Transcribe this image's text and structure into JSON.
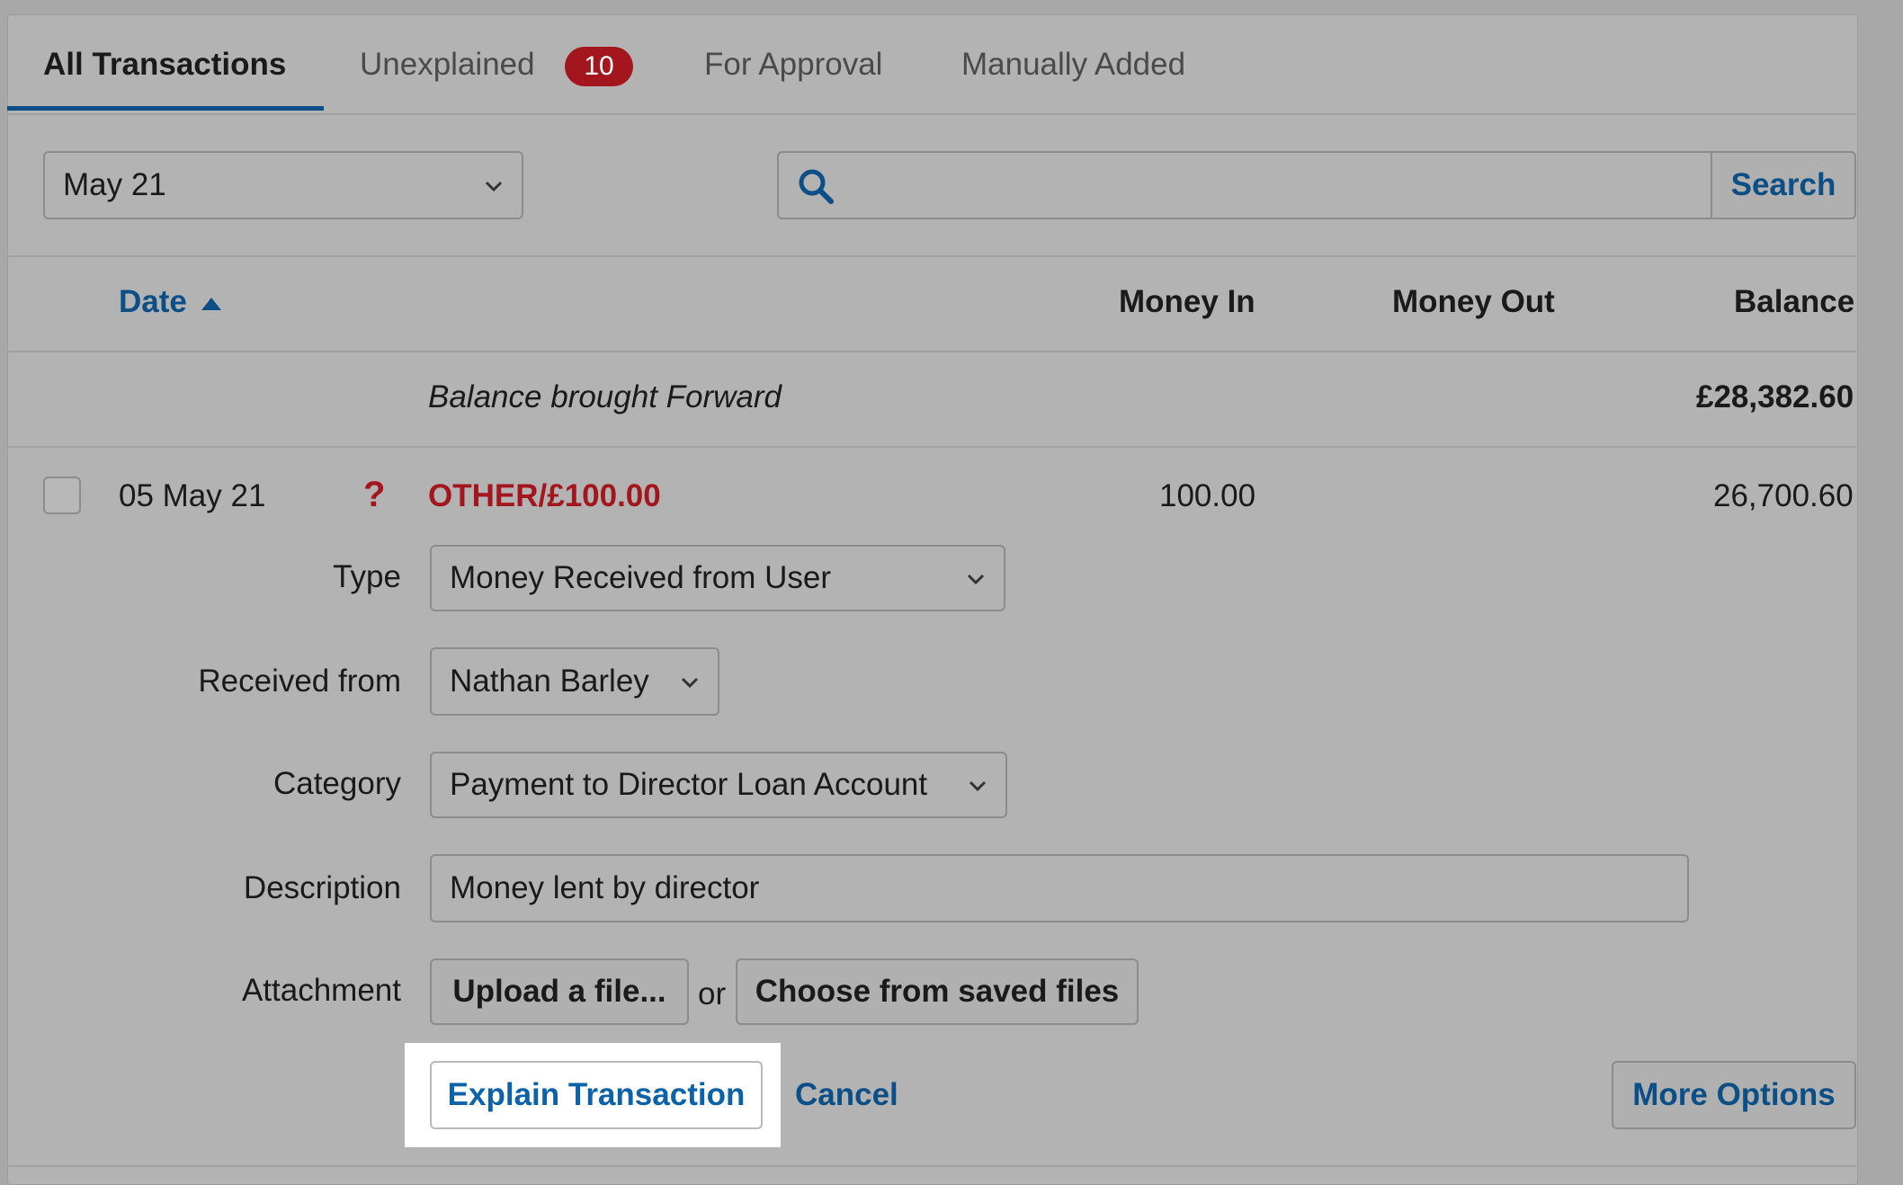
{
  "tabs": [
    {
      "label": "All Transactions"
    },
    {
      "label": "Unexplained",
      "badge": "10"
    },
    {
      "label": "For Approval"
    },
    {
      "label": "Manually Added"
    }
  ],
  "filters": {
    "period": "May 21",
    "search_placeholder": "",
    "search_button": "Search"
  },
  "table": {
    "columns": {
      "date": "Date",
      "money_in": "Money In",
      "money_out": "Money Out",
      "balance": "Balance"
    },
    "brought_forward": {
      "label": "Balance brought Forward",
      "balance": "£28,382.60"
    },
    "transaction": {
      "date": "05 May 21",
      "status_symbol": "?",
      "description": "OTHER/£100.00",
      "money_in": "100.00",
      "money_out": "",
      "balance": "26,700.60"
    }
  },
  "form": {
    "type_label": "Type",
    "type_value": "Money Received from User",
    "received_from_label": "Received from",
    "received_from_value": "Nathan Barley",
    "category_label": "Category",
    "category_value": "Payment to Director Loan Account",
    "description_label": "Description",
    "description_value": "Money lent by director",
    "attachment_label": "Attachment",
    "upload_button": "Upload a file...",
    "or_text": "or",
    "choose_button": "Choose from saved files"
  },
  "actions": {
    "explain": "Explain Transaction",
    "cancel": "Cancel",
    "more": "More Options"
  },
  "colors": {
    "accent": "#0b4f86",
    "badge": "#a3161d",
    "error_text": "#a3161d"
  }
}
